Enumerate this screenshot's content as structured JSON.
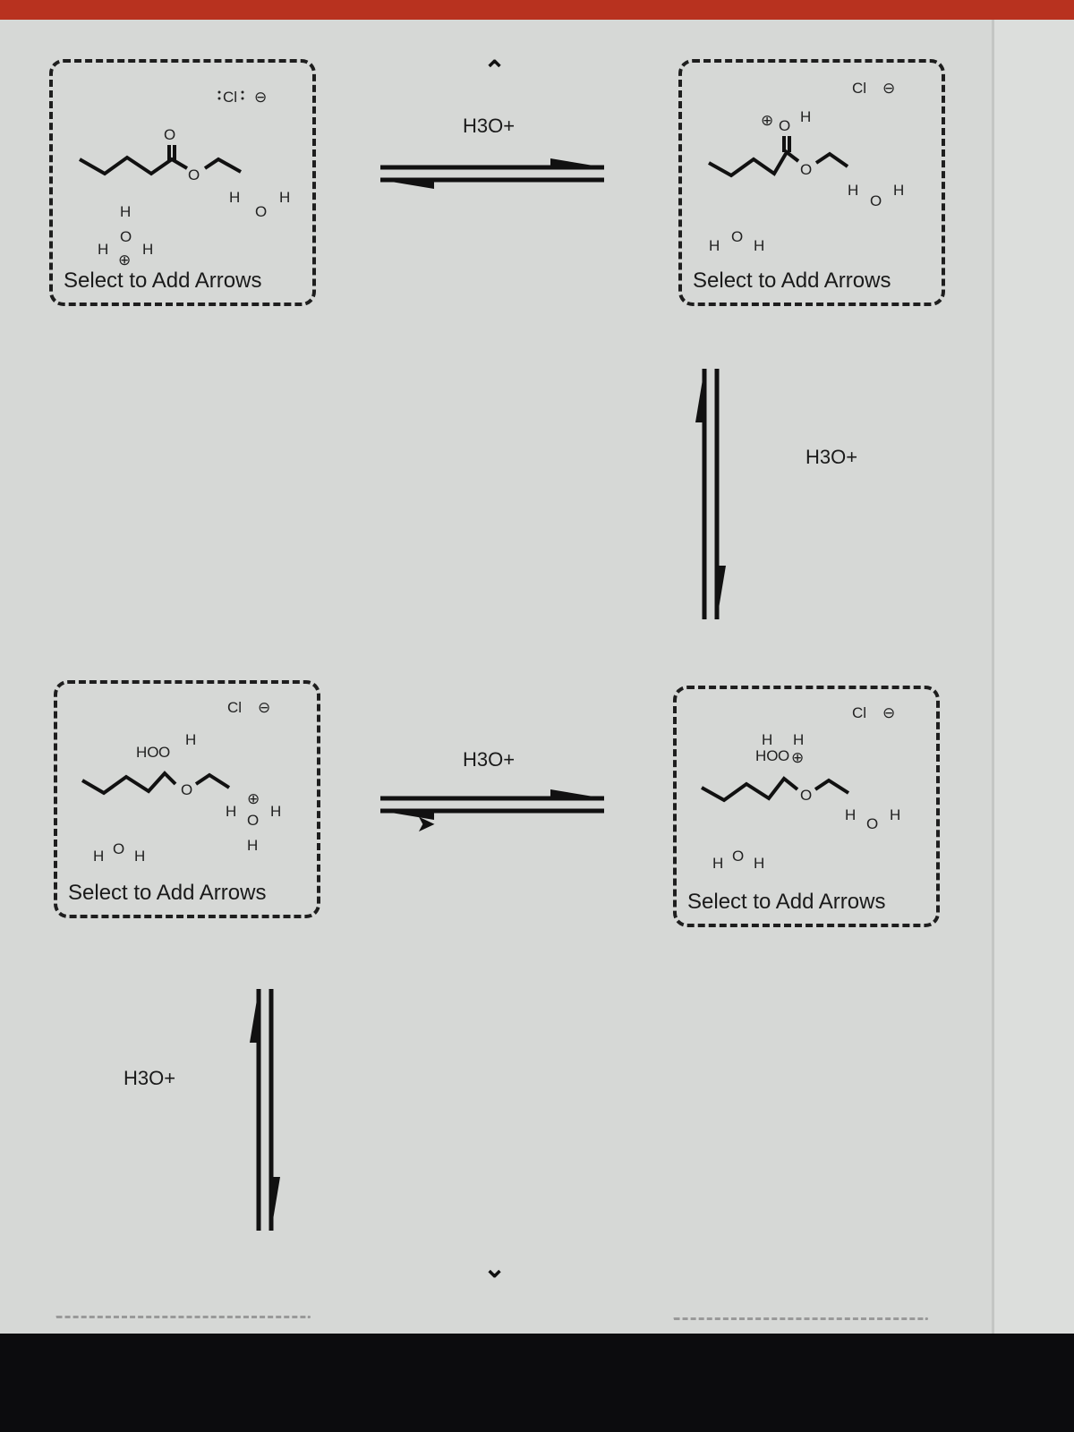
{
  "reagent": "H3O+",
  "select_label": "Select to Add Arrows",
  "nav": {
    "up_icon": "chevron-up-icon",
    "down_icon": "chevron-down-icon"
  },
  "atoms": {
    "cl": "Cl",
    "o": "O",
    "h": "H",
    "ho": "HO",
    "minus": "⊖",
    "plus": "⊕"
  },
  "boxes": [
    {
      "name": "ester-protonation-start",
      "species": [
        "ester",
        "H3O+",
        "H2O",
        "Cl-"
      ]
    },
    {
      "name": "protonated-carbonyl",
      "species": [
        "protonated ester",
        "H2O",
        "H2O",
        "Cl-"
      ]
    },
    {
      "name": "tetrahedral-intermediate",
      "species": [
        "tetrahedral intermediate",
        "H3O+",
        "H2O",
        "Cl-"
      ]
    },
    {
      "name": "protonated-tetrahedral-intermediate",
      "species": [
        "protonated tetrahedral intermediate",
        "H2O",
        "H2O",
        "Cl-"
      ]
    }
  ],
  "colors": {
    "ink": "#1e1e1e",
    "background": "#d6d8d6",
    "top_bar": "#b8321f"
  }
}
